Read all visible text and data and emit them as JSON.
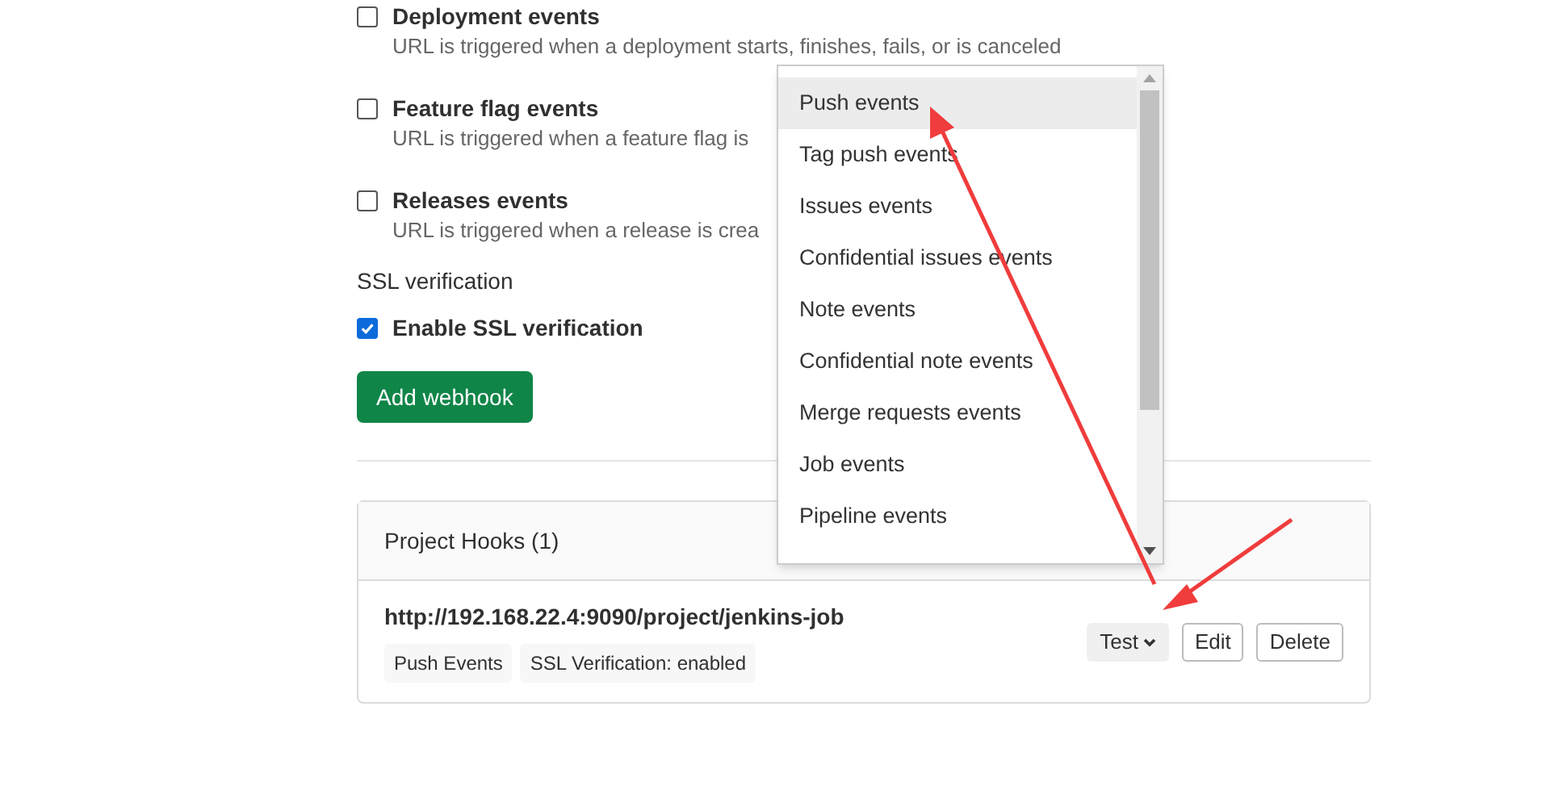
{
  "events": [
    {
      "label": "Deployment events",
      "checked": false,
      "description": "URL is triggered when a deployment starts, finishes, fails, or is canceled"
    },
    {
      "label": "Feature flag events",
      "checked": false,
      "description": "URL is triggered when a feature flag is"
    },
    {
      "label": "Releases events",
      "checked": false,
      "description": "URL is triggered when a release is crea"
    }
  ],
  "ssl": {
    "heading": "SSL verification",
    "label": "Enable SSL verification",
    "checked": true
  },
  "add_button": "Add webhook",
  "hooks_panel": {
    "title": "Project Hooks (1)",
    "hooks": [
      {
        "url": "http://192.168.22.4:9090/project/jenkins-job",
        "badges": [
          "Push Events",
          "SSL Verification: enabled"
        ],
        "test_button": "Test",
        "edit_button": "Edit",
        "delete_button": "Delete"
      }
    ]
  },
  "test_dropdown": {
    "items": [
      {
        "label": "Push events",
        "selected": true
      },
      {
        "label": "Tag push events",
        "selected": false
      },
      {
        "label": "Issues events",
        "selected": false
      },
      {
        "label": "Confidential issues events",
        "selected": false
      },
      {
        "label": "Note events",
        "selected": false
      },
      {
        "label": "Confidential note events",
        "selected": false
      },
      {
        "label": "Merge requests events",
        "selected": false
      },
      {
        "label": "Job events",
        "selected": false
      },
      {
        "label": "Pipeline events",
        "selected": false
      }
    ]
  }
}
